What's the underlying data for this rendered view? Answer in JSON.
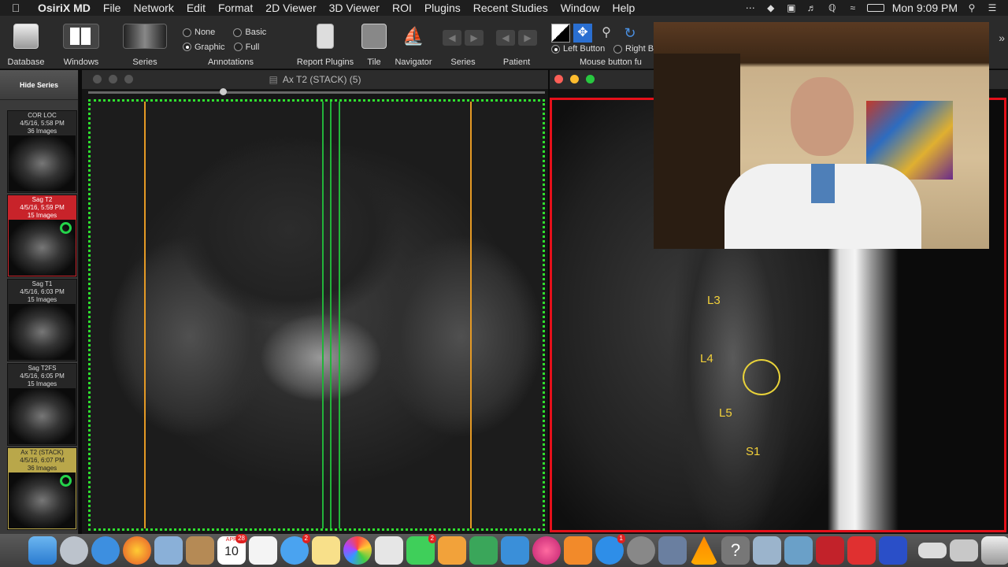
{
  "menubar": {
    "app_name": "OsiriX MD",
    "items": [
      "File",
      "Network",
      "Edit",
      "Format",
      "2D Viewer",
      "3D Viewer",
      "ROI",
      "Plugins",
      "Recent Studies",
      "Window",
      "Help"
    ],
    "clock": "Mon 9:09 PM"
  },
  "toolbar": {
    "database": "Database",
    "windows": "Windows",
    "series": "Series",
    "annotations": "Annotations",
    "annot_none": "None",
    "annot_basic": "Basic",
    "annot_graphic": "Graphic",
    "annot_full": "Full",
    "annot_selected": "Graphic",
    "report_plugins": "Report Plugins",
    "tile": "Tile",
    "navigator": "Navigator",
    "series_nav": "Series",
    "patient": "Patient",
    "left_button": "Left Button",
    "right_button": "Right But",
    "mouse_button": "Mouse button fu"
  },
  "series_panel": {
    "hide_series": "Hide Series",
    "thumbs": [
      {
        "name": "COR LOC",
        "date": "4/5/16, 5:58 PM",
        "count": "36 Images",
        "state": "normal",
        "loaded": false
      },
      {
        "name": "Sag T2",
        "date": "4/5/16, 5:59 PM",
        "count": "15 Images",
        "state": "red",
        "loaded": true
      },
      {
        "name": "Sag T1",
        "date": "4/5/16, 6:03 PM",
        "count": "15 Images",
        "state": "normal",
        "loaded": false
      },
      {
        "name": "Sag T2FS",
        "date": "4/5/16, 6:05 PM",
        "count": "15 Images",
        "state": "normal",
        "loaded": false
      },
      {
        "name": "Ax T2 (STACK)",
        "date": "4/5/16, 6:07 PM",
        "count": "36 Images",
        "state": "yellow",
        "loaded": true
      }
    ]
  },
  "left_viewer": {
    "title": "Ax T2 (STACK) (5)"
  },
  "right_viewer": {
    "labels": [
      "L3",
      "L4",
      "L5",
      "S1"
    ]
  },
  "dock": {
    "calendar_month": "APR",
    "calendar_day": "10",
    "messages_badge": "2",
    "facetime_badge": "2",
    "appstore_badge": "1",
    "calendar_badge": "28"
  },
  "colors": {
    "active_border_green": "#2ee02e",
    "active_border_red": "#e5101a",
    "orange_line": "#e59a25",
    "green_line": "#22b33a",
    "label_yellow": "#f2d03a"
  }
}
